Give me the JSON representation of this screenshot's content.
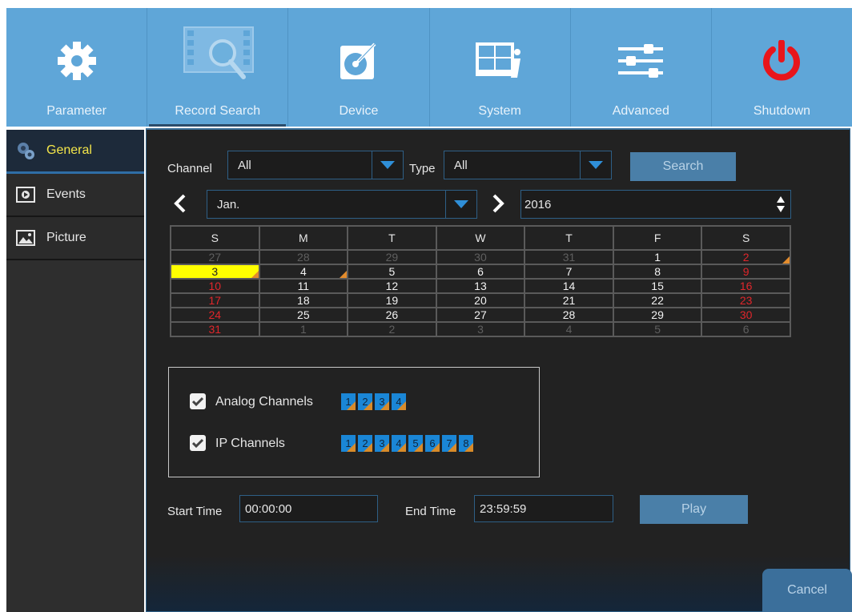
{
  "nav": {
    "items": [
      {
        "label": "Parameter",
        "icon": "gear-icon"
      },
      {
        "label": "Record Search",
        "icon": "record-search-icon",
        "active": true
      },
      {
        "label": "Device",
        "icon": "device-icon"
      },
      {
        "label": "System",
        "icon": "system-icon"
      },
      {
        "label": "Advanced",
        "icon": "advanced-icon"
      },
      {
        "label": "Shutdown",
        "icon": "power-icon"
      }
    ]
  },
  "sidebar": {
    "items": [
      {
        "label": "General",
        "icon": "general-icon",
        "active": true
      },
      {
        "label": "Events",
        "icon": "events-icon"
      },
      {
        "label": "Picture",
        "icon": "picture-icon"
      }
    ]
  },
  "filters": {
    "channel_label": "Channel",
    "channel_value": "All",
    "type_label": "Type",
    "type_value": "All",
    "search_button": "Search"
  },
  "calendar": {
    "month": "Jan.",
    "year": "2016",
    "weekdays": [
      "S",
      "M",
      "T",
      "W",
      "T",
      "F",
      "S"
    ],
    "weeks": [
      [
        {
          "d": "27",
          "s": "dim"
        },
        {
          "d": "28",
          "s": "dim"
        },
        {
          "d": "29",
          "s": "dim"
        },
        {
          "d": "30",
          "s": "dim"
        },
        {
          "d": "31",
          "s": "dim"
        },
        {
          "d": "1",
          "s": "normal"
        },
        {
          "d": "2",
          "s": "weekend",
          "rec": true
        }
      ],
      [
        {
          "d": "3",
          "s": "selected",
          "rec": true
        },
        {
          "d": "4",
          "s": "normal",
          "rec": true
        },
        {
          "d": "5",
          "s": "normal"
        },
        {
          "d": "6",
          "s": "normal"
        },
        {
          "d": "7",
          "s": "normal"
        },
        {
          "d": "8",
          "s": "normal"
        },
        {
          "d": "9",
          "s": "weekend"
        }
      ],
      [
        {
          "d": "10",
          "s": "weekend"
        },
        {
          "d": "11",
          "s": "normal"
        },
        {
          "d": "12",
          "s": "normal"
        },
        {
          "d": "13",
          "s": "normal"
        },
        {
          "d": "14",
          "s": "normal"
        },
        {
          "d": "15",
          "s": "normal"
        },
        {
          "d": "16",
          "s": "weekend"
        }
      ],
      [
        {
          "d": "17",
          "s": "weekend"
        },
        {
          "d": "18",
          "s": "normal"
        },
        {
          "d": "19",
          "s": "normal"
        },
        {
          "d": "20",
          "s": "normal"
        },
        {
          "d": "21",
          "s": "normal"
        },
        {
          "d": "22",
          "s": "normal"
        },
        {
          "d": "23",
          "s": "weekend"
        }
      ],
      [
        {
          "d": "24",
          "s": "weekend"
        },
        {
          "d": "25",
          "s": "normal"
        },
        {
          "d": "26",
          "s": "normal"
        },
        {
          "d": "27",
          "s": "normal"
        },
        {
          "d": "28",
          "s": "normal"
        },
        {
          "d": "29",
          "s": "normal"
        },
        {
          "d": "30",
          "s": "weekend"
        }
      ],
      [
        {
          "d": "31",
          "s": "weekend"
        },
        {
          "d": "1",
          "s": "dim"
        },
        {
          "d": "2",
          "s": "dim"
        },
        {
          "d": "3",
          "s": "dim"
        },
        {
          "d": "4",
          "s": "dim"
        },
        {
          "d": "5",
          "s": "dim"
        },
        {
          "d": "6",
          "s": "dim"
        }
      ]
    ]
  },
  "channels": {
    "analog_label": "Analog Channels",
    "analog": [
      "1",
      "2",
      "3",
      "4"
    ],
    "ip_label": "IP Channels",
    "ip": [
      "1",
      "2",
      "3",
      "4",
      "5",
      "6",
      "7",
      "8"
    ]
  },
  "time": {
    "start_label": "Start Time",
    "start_value": "00:00:00",
    "end_label": "End Time",
    "end_value": "23:59:59",
    "play_button": "Play"
  },
  "cancel_button": "Cancel",
  "colors": {
    "nav_bg": "#5fa6d8",
    "accent_yellow": "#f4e64a",
    "weekend_red": "#e0262b",
    "record_flag": "#e38c2d",
    "channel_blue": "#1a86d6"
  }
}
